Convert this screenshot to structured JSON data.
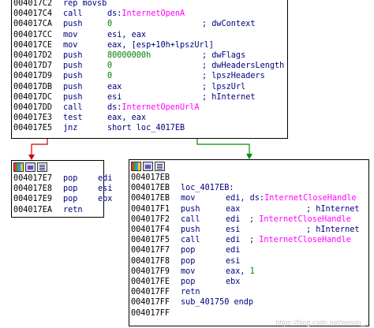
{
  "colors": {
    "address": "#000000",
    "instruction": "#000080",
    "api_name": "#ff00ff",
    "number": "#008000",
    "false_branch": "#d00000",
    "true_branch": "#009000",
    "background": "#ffffff"
  },
  "top_block": {
    "lines": [
      {
        "addr": "004017C2",
        "mn": "rep movsb",
        "op": "",
        "cm": ""
      },
      {
        "addr": "004017C4",
        "mn": "call",
        "op": "ds:",
        "sym": "InternetOpenA",
        "cm": ""
      },
      {
        "addr": "004017CA",
        "mn": "push",
        "num": "0",
        "cm": "; dwContext"
      },
      {
        "addr": "004017CC",
        "mn": "mov",
        "op": "esi, eax",
        "cm": ""
      },
      {
        "addr": "004017CE",
        "mn": "mov",
        "op": "eax, [esp+10h+lpszUrl]",
        "cm": ""
      },
      {
        "addr": "004017D2",
        "mn": "push",
        "num": "80000000h",
        "cm": "; dwFlags"
      },
      {
        "addr": "004017D7",
        "mn": "push",
        "num": "0",
        "cm": "; dwHeadersLength"
      },
      {
        "addr": "004017D9",
        "mn": "push",
        "num": "0",
        "cm": "; lpszHeaders"
      },
      {
        "addr": "004017DB",
        "mn": "push",
        "op": "eax",
        "cm": "; lpszUrl"
      },
      {
        "addr": "004017DC",
        "mn": "push",
        "op": "esi",
        "cm": "; hInternet"
      },
      {
        "addr": "004017DD",
        "mn": "call",
        "op": "ds:",
        "sym": "InternetOpenUrlA",
        "cm": ""
      },
      {
        "addr": "004017E3",
        "mn": "test",
        "op": "eax, eax",
        "cm": ""
      },
      {
        "addr": "004017E5",
        "mn": "jnz",
        "op": "short loc_4017EB",
        "cm": ""
      }
    ]
  },
  "left_block": {
    "icons": [
      "graph-colors-icon",
      "picture-icon",
      "text-view-icon"
    ],
    "lines": [
      {
        "addr": "004017E7",
        "mn": "pop",
        "op": "edi"
      },
      {
        "addr": "004017E8",
        "mn": "pop",
        "op": "esi"
      },
      {
        "addr": "004017E9",
        "mn": "pop",
        "op": "ebx"
      },
      {
        "addr": "004017EA",
        "mn": "retn",
        "op": ""
      }
    ]
  },
  "right_block": {
    "icons": [
      "graph-colors-icon",
      "picture-icon",
      "text-view-icon"
    ],
    "lines": [
      {
        "addr": "004017EB",
        "mn": "",
        "op": ""
      },
      {
        "addr": "004017EB",
        "mn": "loc_4017EB:",
        "op": ""
      },
      {
        "addr": "004017EB",
        "mn": "mov",
        "op": "edi, ds:",
        "sym": "InternetCloseHandle"
      },
      {
        "addr": "004017F1",
        "mn": "push",
        "op": "eax",
        "cm": "; hInternet"
      },
      {
        "addr": "004017F2",
        "mn": "call",
        "op": "edi",
        "cm": "; ",
        "cmsym": "InternetCloseHandle"
      },
      {
        "addr": "004017F4",
        "mn": "push",
        "op": "esi",
        "cm": "; hInternet"
      },
      {
        "addr": "004017F5",
        "mn": "call",
        "op": "edi",
        "cm": "; ",
        "cmsym": "InternetCloseHandle"
      },
      {
        "addr": "004017F7",
        "mn": "pop",
        "op": "edi"
      },
      {
        "addr": "004017F8",
        "mn": "pop",
        "op": "esi"
      },
      {
        "addr": "004017F9",
        "mn": "mov",
        "op": "eax, ",
        "num": "1"
      },
      {
        "addr": "004017FE",
        "mn": "pop",
        "op": "ebx"
      },
      {
        "addr": "004017FF",
        "mn": "retn",
        "op": ""
      },
      {
        "addr": "004017FF",
        "mn": "sub_401750 endp",
        "op": ""
      },
      {
        "addr": "004017FF",
        "mn": "",
        "op": ""
      }
    ]
  },
  "watermark": "https://blog.csdn.net/weixin_..."
}
